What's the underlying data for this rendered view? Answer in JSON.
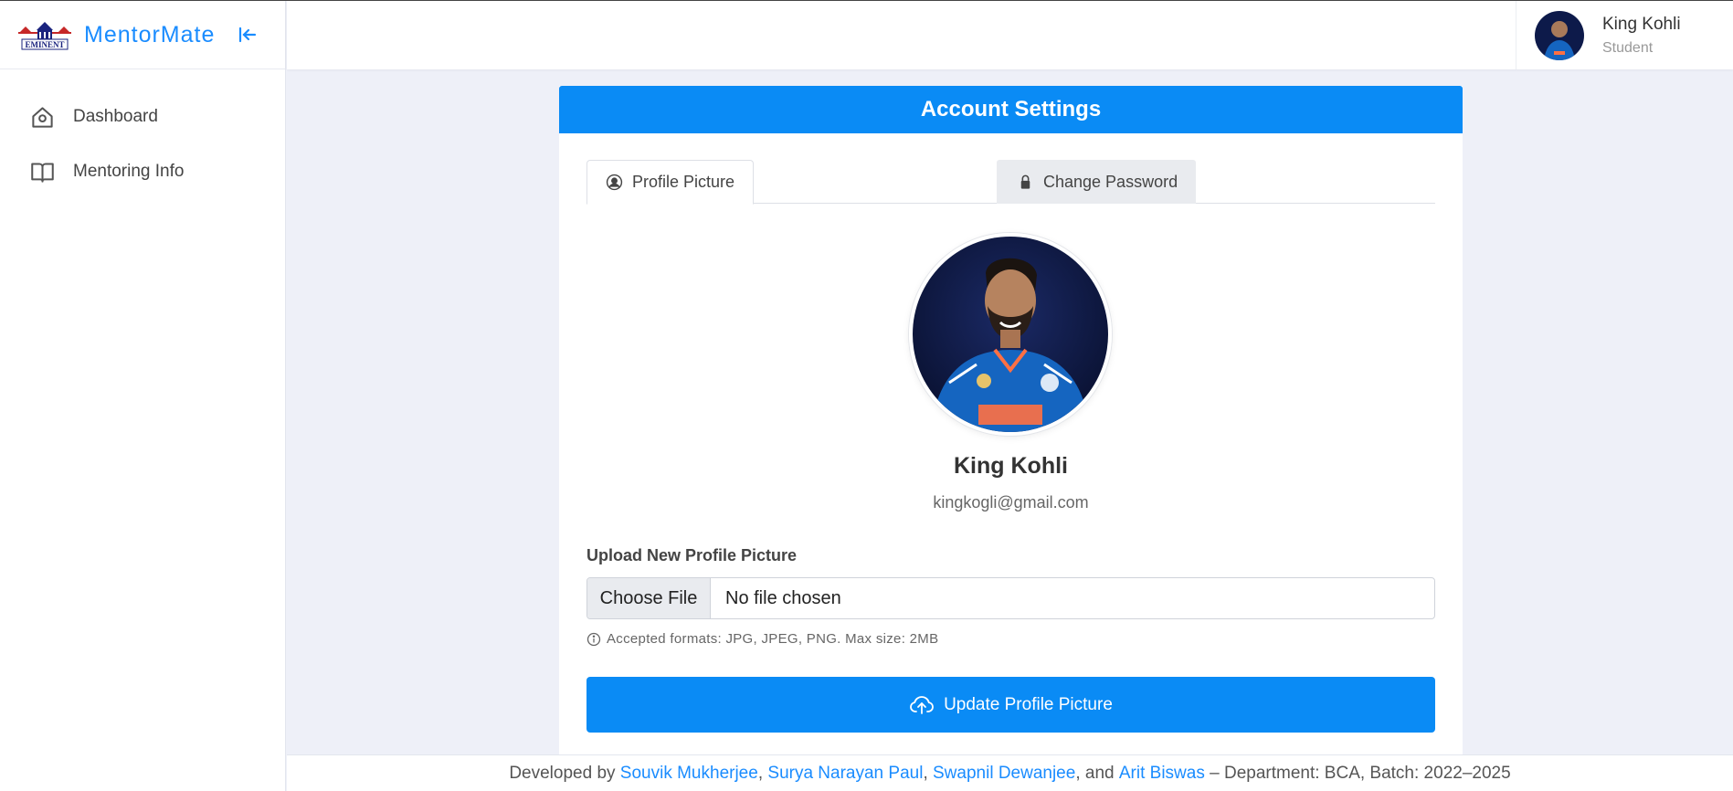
{
  "brand": {
    "name": "MentorMate",
    "logo_text": "EMINENT"
  },
  "sidebar": {
    "items": [
      {
        "label": "Dashboard",
        "icon": "home-icon"
      },
      {
        "label": "Mentoring Info",
        "icon": "book-icon"
      }
    ]
  },
  "header": {
    "user": {
      "name": "King Kohli",
      "role": "Student"
    }
  },
  "card": {
    "title": "Account Settings",
    "tabs": [
      {
        "label": "Profile Picture",
        "icon": "user-circle-icon",
        "active": true
      },
      {
        "label": "Change Password",
        "icon": "lock-icon",
        "active": false
      }
    ],
    "profile": {
      "name": "King Kohli",
      "email": "kingkogli@gmail.com"
    },
    "upload": {
      "label": "Upload New Profile Picture",
      "choose_file": "Choose File",
      "file_status": "No file chosen",
      "hint": "Accepted formats: JPG, JPEG, PNG. Max size: 2MB",
      "button": "Update Profile Picture"
    }
  },
  "footer": {
    "prefix": "Developed by ",
    "developers": [
      "Souvik Mukherjee",
      "Surya Narayan Paul",
      "Swapnil Dewanjee",
      "Arit Biswas"
    ],
    "sep1": ", ",
    "sep2": ", ",
    "sep3": ", and ",
    "suffix": " – Department: BCA, Batch: 2022–2025"
  },
  "colors": {
    "accent": "#0a8bf5",
    "link": "#1a8cff",
    "background": "#eef0f8"
  }
}
